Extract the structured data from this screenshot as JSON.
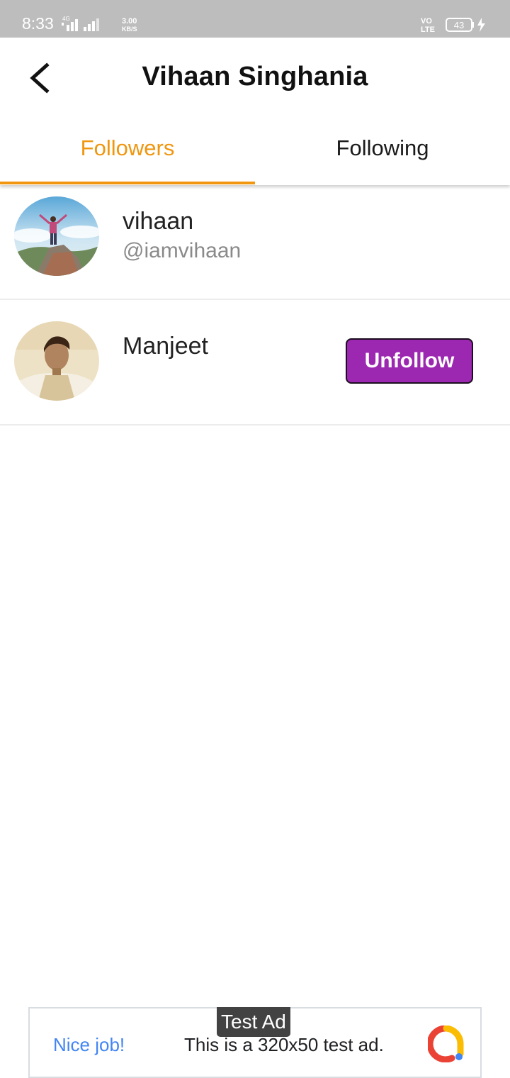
{
  "status_bar": {
    "time": "8:33",
    "network_speed": "3.00",
    "network_unit": "KB/S",
    "network_type": "4G",
    "volte": "VO LTE",
    "battery": "43"
  },
  "app_bar": {
    "back_icon": "back-arrow-icon",
    "title": "Vihaan Singhania"
  },
  "tabs": [
    {
      "label": "Followers",
      "active": true
    },
    {
      "label": "Following",
      "active": false
    }
  ],
  "accent_color": "#f0960f",
  "followers": [
    {
      "name": "vihaan",
      "handle": "@iamvihaan",
      "action": ""
    },
    {
      "name": "Manjeet",
      "handle": "",
      "action": "Unfollow"
    }
  ],
  "unfollow_color": "#9c27b0",
  "ad": {
    "badge": "Test Ad",
    "headline": "Nice job!",
    "body": "This is a 320x50 test ad."
  }
}
